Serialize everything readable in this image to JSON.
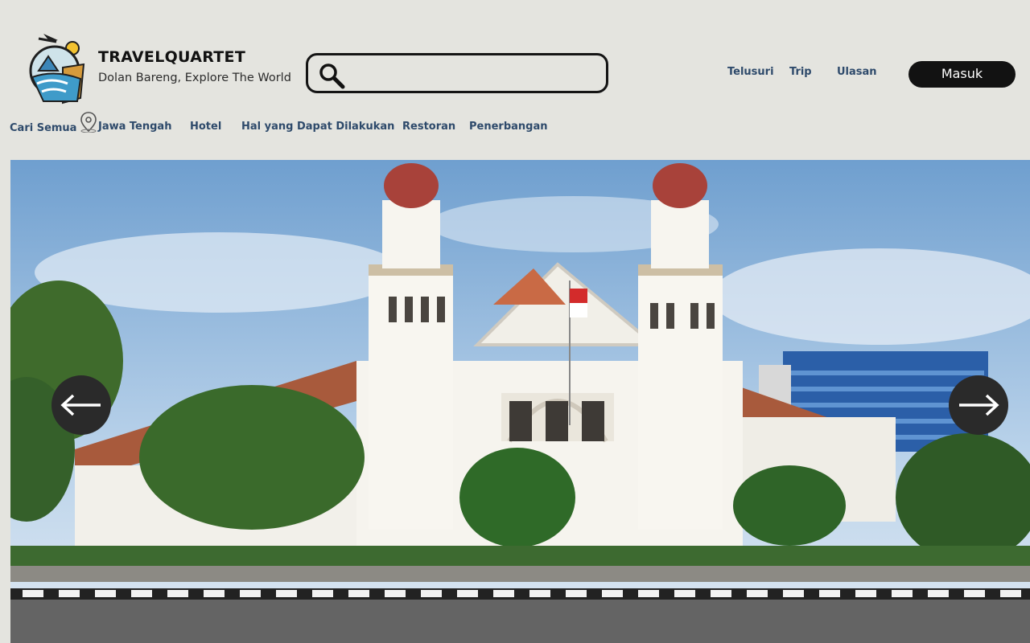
{
  "brand": {
    "name": "TRAVELQUARTET",
    "tagline": "Dolan Bareng, Explore The World"
  },
  "search": {
    "value": "",
    "placeholder": ""
  },
  "top_nav": [
    "Telusuri",
    "Trip",
    "Ulasan"
  ],
  "login_label": "Masuk",
  "sub_nav": {
    "all": "Cari Semua",
    "location": "Jawa Tengah",
    "items": [
      "Hotel",
      "Hal yang Dapat Dilakukan",
      "Restoran",
      "Penerbangan"
    ]
  },
  "icons": {
    "logo": "travelquartet-logo",
    "search": "search-icon",
    "location": "map-pin-icon",
    "prev": "arrow-left-icon",
    "next": "arrow-right-icon"
  },
  "colors": {
    "background": "#e4e4df",
    "nav_link": "#2e4a6b",
    "button": "#121212"
  }
}
